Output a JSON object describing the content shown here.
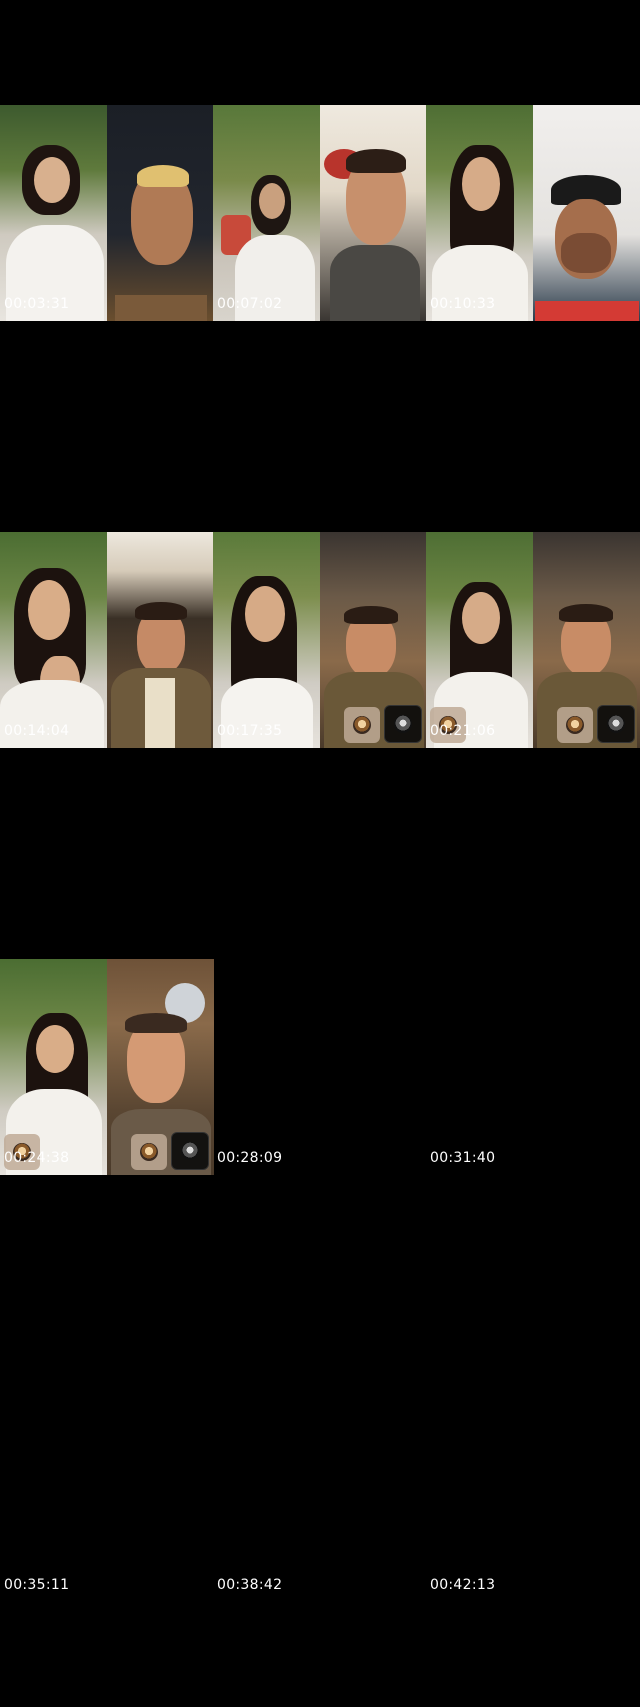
{
  "timestamps": [
    "00:03:31",
    "00:07:02",
    "00:10:33",
    "00:14:04",
    "00:17:35",
    "00:21:06",
    "00:24:38",
    "00:28:09",
    "00:31:40",
    "00:35:11",
    "00:38:42",
    "00:42:13"
  ]
}
